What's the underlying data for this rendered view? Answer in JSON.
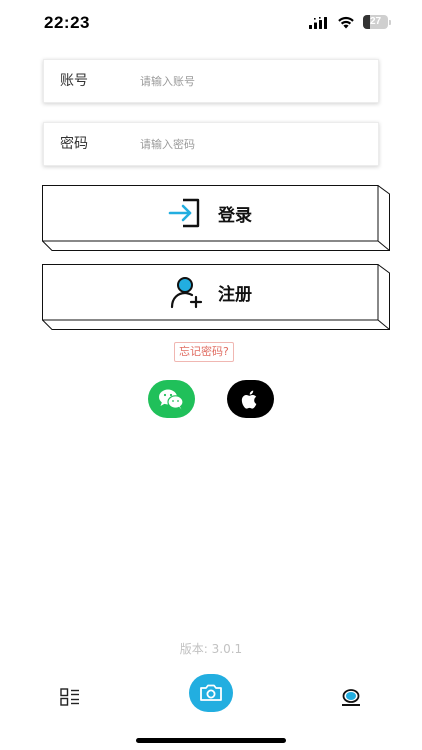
{
  "status_bar": {
    "time": "22:23",
    "battery_level": "27",
    "battery_fraction": 0.27
  },
  "form": {
    "account": {
      "label": "账号",
      "placeholder": "请输入账号"
    },
    "password": {
      "label": "密码",
      "placeholder": "请输入密码"
    }
  },
  "buttons": {
    "login": {
      "label": "登录",
      "icon": "login-icon"
    },
    "register": {
      "label": "注册",
      "icon": "add-user-icon"
    }
  },
  "forgot_password": "忘记密码?",
  "social_login": [
    {
      "name": "wechat",
      "icon": "wechat-icon",
      "color": "#20c05a"
    },
    {
      "name": "apple",
      "icon": "apple-icon",
      "color": "#000000"
    }
  ],
  "version": "版本: 3.0.1",
  "nav": [
    {
      "name": "list",
      "icon": "list-icon"
    },
    {
      "name": "camera",
      "icon": "camera-icon",
      "color": "#22aee0"
    },
    {
      "name": "profile",
      "icon": "profile-icon"
    }
  ],
  "colors": {
    "accent": "#22aee0",
    "forgot_text": "#e06d62",
    "forgot_border": "#f0b7b2",
    "version_text": "#c2c2c2"
  }
}
